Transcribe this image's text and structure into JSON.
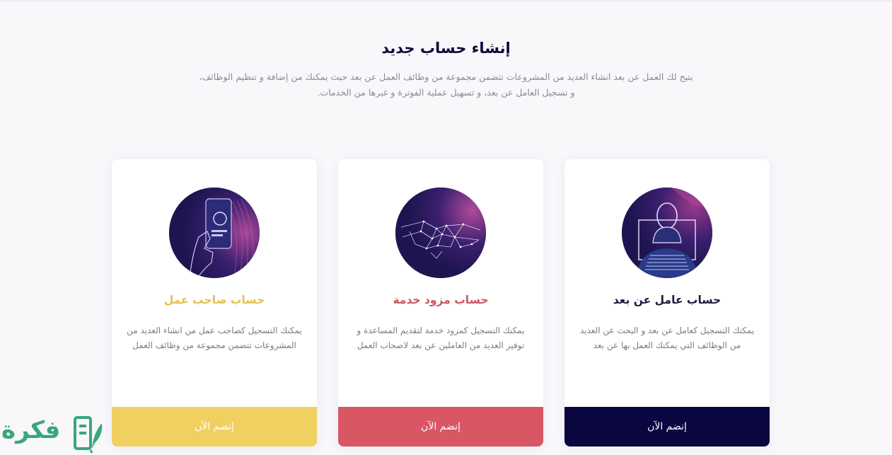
{
  "header": {
    "title": "إنشاء حساب جديد",
    "description": "يتيح لك العمل عن بعد انشاء العديد من المشروعات تتضمن مجموعة من وظائف العمل عن بعد حيث يمكنك من إضافة و تنظيم الوظائف، و تسجيل العامل عن بعد، و تسهيل عملية الفوترة و غيرها من الخدمات."
  },
  "cards": [
    {
      "title": "حساب عامل عن بعد",
      "title_color": "#1b1b3f",
      "description": "يمكنك التسجيل كعامل عن بعد و البحث عن العديد من الوظائف التي يمكنك العمل بها عن بعد",
      "button_label": "إنضم الآن",
      "button_color": "#0a0640",
      "icon": "remote-worker-illustration"
    },
    {
      "title": "حساب مزود خدمة",
      "title_color": "#c85661",
      "description": "يمكنك التسجيل كمزود خدمة لتقديم المساعدة و توفير العديد من العاملين عن بعد لاصحاب العمل",
      "button_label": "إنضم الآن",
      "button_color": "#d95665",
      "icon": "handshake-illustration"
    },
    {
      "title": "حساب صاحب عمل",
      "title_color": "#e3c04e",
      "description": "يمكنك التسجيل كصاحب عمل من انشاء العديد من المشروعات تتضمن مجموعة من وظائف العمل",
      "button_label": "إنضم الآن",
      "button_color": "#f0d060",
      "icon": "phone-in-hand-illustration"
    }
  ],
  "watermark": {
    "text": "فكرة",
    "icon": "book-leaf-logo-icon",
    "color": "#3aa77a"
  }
}
